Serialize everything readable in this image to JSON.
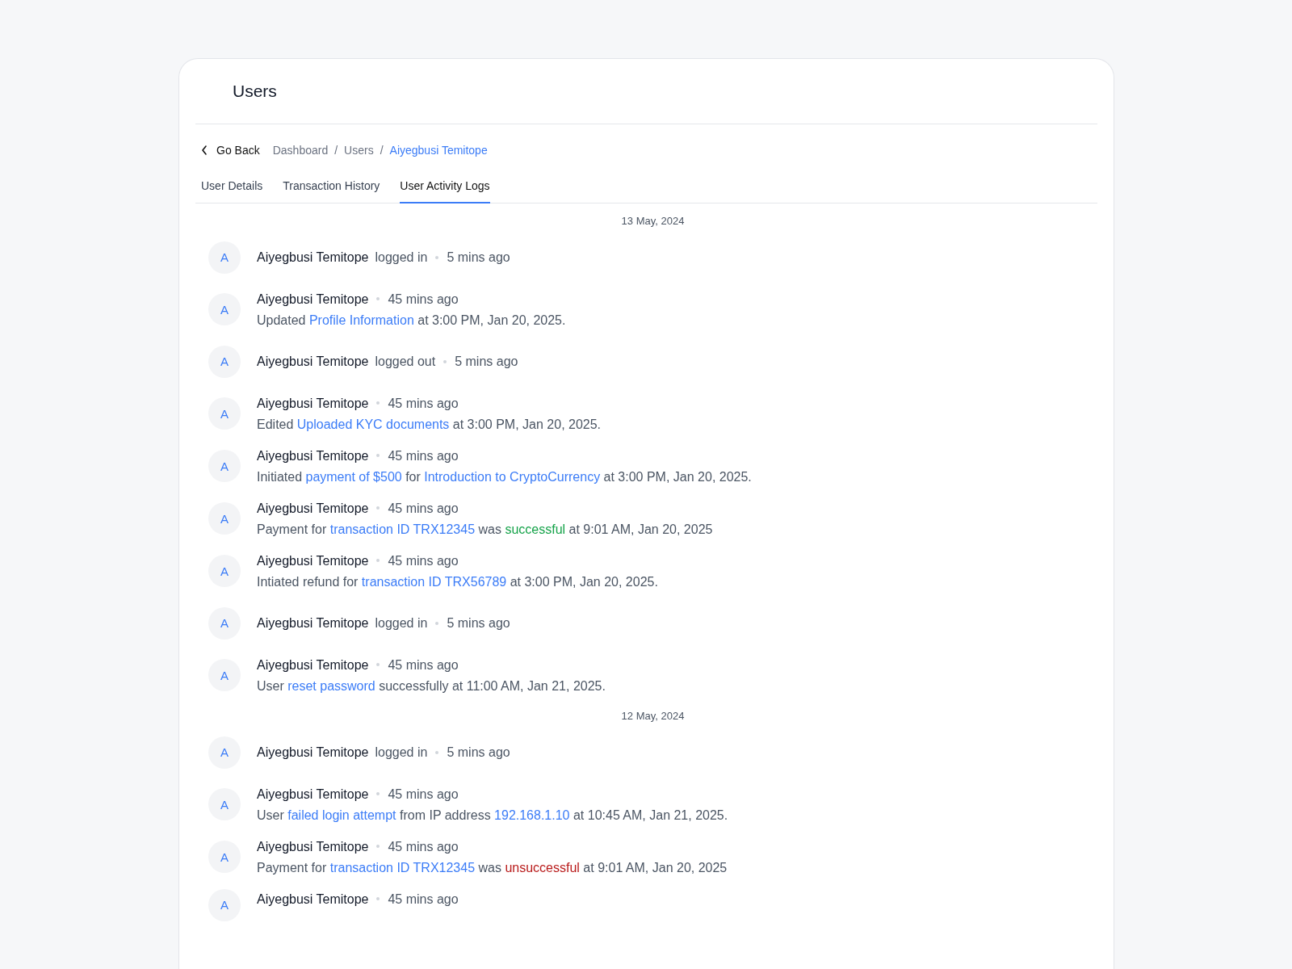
{
  "page": {
    "title": "Users"
  },
  "breadcrumb": {
    "back": "Go Back",
    "items": [
      {
        "label": "Dashboard",
        "current": false
      },
      {
        "label": "Users",
        "current": false
      },
      {
        "label": "Aiyegbusi Temitope",
        "current": true
      }
    ],
    "separator": "/"
  },
  "tabs": [
    {
      "label": "User Details",
      "selected": false
    },
    {
      "label": "Transaction History",
      "selected": false
    },
    {
      "label": "User Activity Logs",
      "selected": true
    }
  ],
  "groups": [
    {
      "date": "13 May, 2024",
      "entries": [
        {
          "kind": "inline",
          "avatar": "A",
          "user": "Aiyegbusi Temitope",
          "action": "logged in",
          "time": "5 mins ago"
        },
        {
          "kind": "detail",
          "avatar": "A",
          "user": "Aiyegbusi Temitope",
          "time": "45 mins ago",
          "description": [
            {
              "kind": "text",
              "text": "Updated "
            },
            {
              "kind": "link",
              "text": "Profile Information"
            },
            {
              "kind": "text",
              "text": " at 3:00 PM, Jan 20, 2025."
            }
          ]
        },
        {
          "kind": "inline",
          "avatar": "A",
          "user": "Aiyegbusi Temitope",
          "action": "logged out",
          "time": "5 mins ago"
        },
        {
          "kind": "detail",
          "avatar": "A",
          "user": "Aiyegbusi Temitope",
          "time": "45 mins ago",
          "description": [
            {
              "kind": "text",
              "text": "Edited "
            },
            {
              "kind": "link",
              "text": "Uploaded KYC documents"
            },
            {
              "kind": "text",
              "text": " at 3:00 PM, Jan 20, 2025."
            }
          ]
        },
        {
          "kind": "detail",
          "avatar": "A",
          "user": "Aiyegbusi Temitope",
          "time": "45 mins ago",
          "description": [
            {
              "kind": "text",
              "text": "Initiated "
            },
            {
              "kind": "link",
              "text": "payment of $500"
            },
            {
              "kind": "text",
              "text": " for "
            },
            {
              "kind": "link",
              "text": "Introduction to CryptoCurrency"
            },
            {
              "kind": "text",
              "text": " at 3:00 PM, Jan 20, 2025."
            }
          ]
        },
        {
          "kind": "detail",
          "avatar": "A",
          "user": "Aiyegbusi Temitope",
          "time": "45 mins ago",
          "description": [
            {
              "kind": "text",
              "text": "Payment for "
            },
            {
              "kind": "link",
              "text": "transaction ID TRX12345"
            },
            {
              "kind": "text",
              "text": " was "
            },
            {
              "kind": "success",
              "text": "successful"
            },
            {
              "kind": "text",
              "text": " at 9:01 AM, Jan 20, 2025"
            }
          ]
        },
        {
          "kind": "detail",
          "avatar": "A",
          "user": "Aiyegbusi Temitope",
          "time": "45 mins ago",
          "description": [
            {
              "kind": "text",
              "text": "Intiated refund for "
            },
            {
              "kind": "link",
              "text": "transaction ID TRX56789"
            },
            {
              "kind": "text",
              "text": " at 3:00 PM, Jan 20, 2025."
            }
          ]
        },
        {
          "kind": "inline",
          "avatar": "A",
          "user": "Aiyegbusi Temitope",
          "action": "logged in",
          "time": "5 mins ago"
        },
        {
          "kind": "detail",
          "avatar": "A",
          "user": "Aiyegbusi Temitope",
          "time": "45 mins ago",
          "description": [
            {
              "kind": "text",
              "text": "User "
            },
            {
              "kind": "link",
              "text": "reset password"
            },
            {
              "kind": "text",
              "text": " successfully at 11:00 AM, Jan 21, 2025."
            }
          ]
        }
      ]
    },
    {
      "date": "12 May, 2024",
      "entries": [
        {
          "kind": "inline",
          "avatar": "A",
          "user": "Aiyegbusi Temitope",
          "action": "logged in",
          "time": "5 mins ago"
        },
        {
          "kind": "detail",
          "avatar": "A",
          "user": "Aiyegbusi Temitope",
          "time": "45 mins ago",
          "description": [
            {
              "kind": "text",
              "text": "User "
            },
            {
              "kind": "link",
              "text": "failed login attempt"
            },
            {
              "kind": "text",
              "text": " from IP address "
            },
            {
              "kind": "link",
              "text": "192.168.1.10"
            },
            {
              "kind": "text",
              "text": " at 10:45 AM, Jan 21, 2025."
            }
          ]
        },
        {
          "kind": "detail",
          "avatar": "A",
          "user": "Aiyegbusi Temitope",
          "time": "45 mins ago",
          "description": [
            {
              "kind": "text",
              "text": "Payment for "
            },
            {
              "kind": "link",
              "text": "transaction ID TRX12345"
            },
            {
              "kind": "text",
              "text": " was "
            },
            {
              "kind": "error",
              "text": "unsuccessful"
            },
            {
              "kind": "text",
              "text": " at 9:01 AM, Jan 20, 2025"
            }
          ]
        },
        {
          "kind": "partial",
          "avatar": "A",
          "user": "Aiyegbusi Temitope",
          "time": "45 mins ago"
        }
      ]
    }
  ]
}
